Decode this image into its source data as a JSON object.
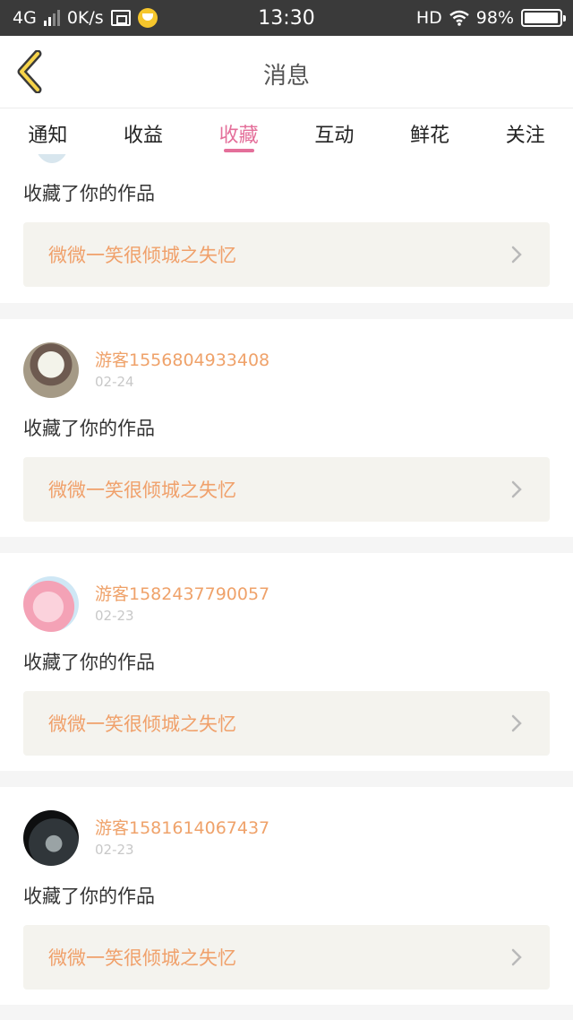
{
  "status_bar": {
    "network": "4G",
    "speed": "0K/s",
    "time": "13:30",
    "hd": "HD",
    "battery": "98%",
    "battery_level": 0.98
  },
  "header": {
    "title": "消息"
  },
  "tabs": [
    {
      "label": "通知",
      "active": false
    },
    {
      "label": "收益",
      "active": false
    },
    {
      "label": "收藏",
      "active": true
    },
    {
      "label": "互动",
      "active": false
    },
    {
      "label": "鲜花",
      "active": false
    },
    {
      "label": "关注",
      "active": false
    }
  ],
  "accent_color": "#e46f9a",
  "name_color": "#efa26a",
  "cards": [
    {
      "action": "收藏了你的作品",
      "work": "微微一笑很倾城之失忆"
    },
    {
      "username": "游客1556804933408",
      "date": "02-24",
      "action": "收藏了你的作品",
      "work": "微微一笑很倾城之失忆"
    },
    {
      "username": "游客1582437790057",
      "date": "02-23",
      "action": "收藏了你的作品",
      "work": "微微一笑很倾城之失忆"
    },
    {
      "username": "游客1581614067437",
      "date": "02-23",
      "action": "收藏了你的作品",
      "work": "微微一笑很倾城之失忆"
    }
  ]
}
